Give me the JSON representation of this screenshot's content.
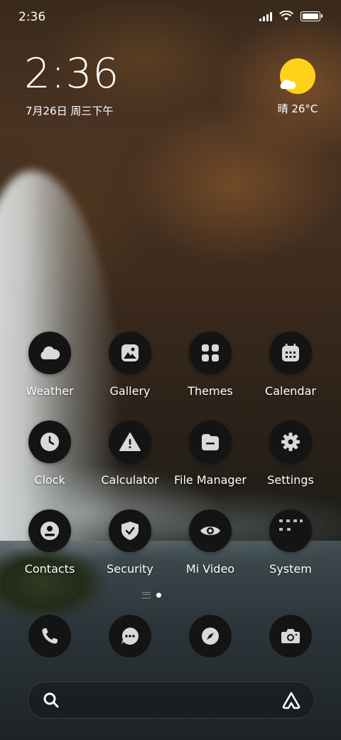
{
  "status_bar": {
    "time": "2:36"
  },
  "clock_widget": {
    "time": "2:36",
    "date": "7月26日 周三下午",
    "weather": "晴 26°C"
  },
  "apps": [
    {
      "label": "Weather",
      "icon": "weather-icon"
    },
    {
      "label": "Gallery",
      "icon": "gallery-icon"
    },
    {
      "label": "Themes",
      "icon": "themes-icon"
    },
    {
      "label": "Calendar",
      "icon": "calendar-icon"
    },
    {
      "label": "Clock",
      "icon": "clock-icon"
    },
    {
      "label": "Calculator",
      "icon": "calculator-icon"
    },
    {
      "label": "File Manager",
      "icon": "file-manager-icon"
    },
    {
      "label": "Settings",
      "icon": "settings-icon"
    },
    {
      "label": "Contacts",
      "icon": "contacts-icon"
    },
    {
      "label": "Security",
      "icon": "security-icon"
    },
    {
      "label": "Mi Video",
      "icon": "mi-video-icon"
    },
    {
      "label": "System",
      "icon": "system-folder-icon"
    }
  ],
  "dock": [
    "phone-icon",
    "messages-icon",
    "browser-icon",
    "camera-icon"
  ],
  "search": {
    "icons": [
      "search-icon",
      "assistant-icon"
    ]
  },
  "colors": {
    "sun": "#ffd21a",
    "icon_bg": "#141414",
    "icon_glyph": "#d9d9d9"
  }
}
